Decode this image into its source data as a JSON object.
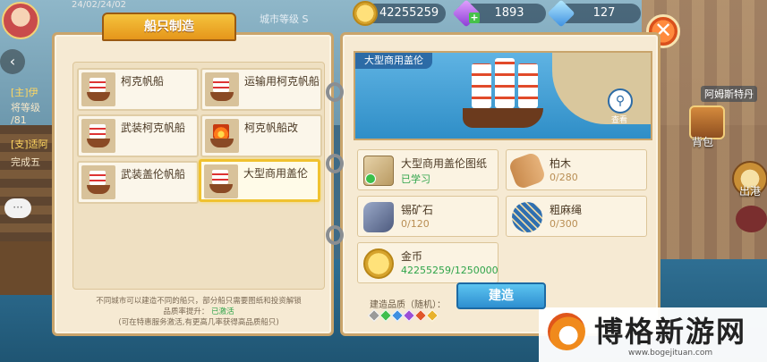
{
  "hud": {
    "top_small_text": "24/02/24/02",
    "city_level": "城市等级 S",
    "gold": "42255259",
    "gem_purple": "1893",
    "gem_blue": "127",
    "close_symbol": "✕"
  },
  "left_side": {
    "back_symbol": "‹",
    "quest1_tag": "[主]伊",
    "quest1_line2": "将等级",
    "quest1_line3": "/81",
    "quest2_tag": "[支]适阿",
    "quest2_line2": "完成五",
    "chat_symbol": "···"
  },
  "right_side": {
    "map_label": "阿姆斯特丹",
    "bag_label": "背包",
    "port_label": "出港"
  },
  "book": {
    "tab_title": "船只制造",
    "ships": [
      {
        "name": "柯克帆船"
      },
      {
        "name": "运输用柯克帆船"
      },
      {
        "name": "武装柯克帆船"
      },
      {
        "name": "柯克帆船改"
      },
      {
        "name": "武装盖伦帆船"
      },
      {
        "name": "大型商用盖伦"
      }
    ],
    "footer_line1": "不同城市可以建造不同的船只，部分船只需要图纸和投资解锁",
    "footer_line2": "品质率提升：",
    "footer_status": "已激活",
    "footer_line3": "(可在特惠服务激活,有更高几率获得高品质船只)",
    "preview_title": "大型商用盖伦",
    "zoom_label": "查看",
    "materials": {
      "blueprint_name": "大型商用盖伦图纸",
      "blueprint_status": "已学习",
      "wood_name": "柏木",
      "wood_val": "0/280",
      "tin_name": "锡矿石",
      "tin_val": "0/120",
      "rope_name": "粗麻绳",
      "rope_val": "0/300",
      "gold_name": "金币",
      "gold_val": "42255259/1250000"
    },
    "quality_label": "建造品质（随机）：",
    "quality_colors": [
      "#9a9a9a",
      "#3fbf4f",
      "#3f8fe0",
      "#9b4fd6",
      "#e0562a",
      "#e8b22c"
    ],
    "build_label": "建造"
  },
  "watermark": {
    "text": "博格新游网",
    "url": "www.bogejituan.com"
  }
}
